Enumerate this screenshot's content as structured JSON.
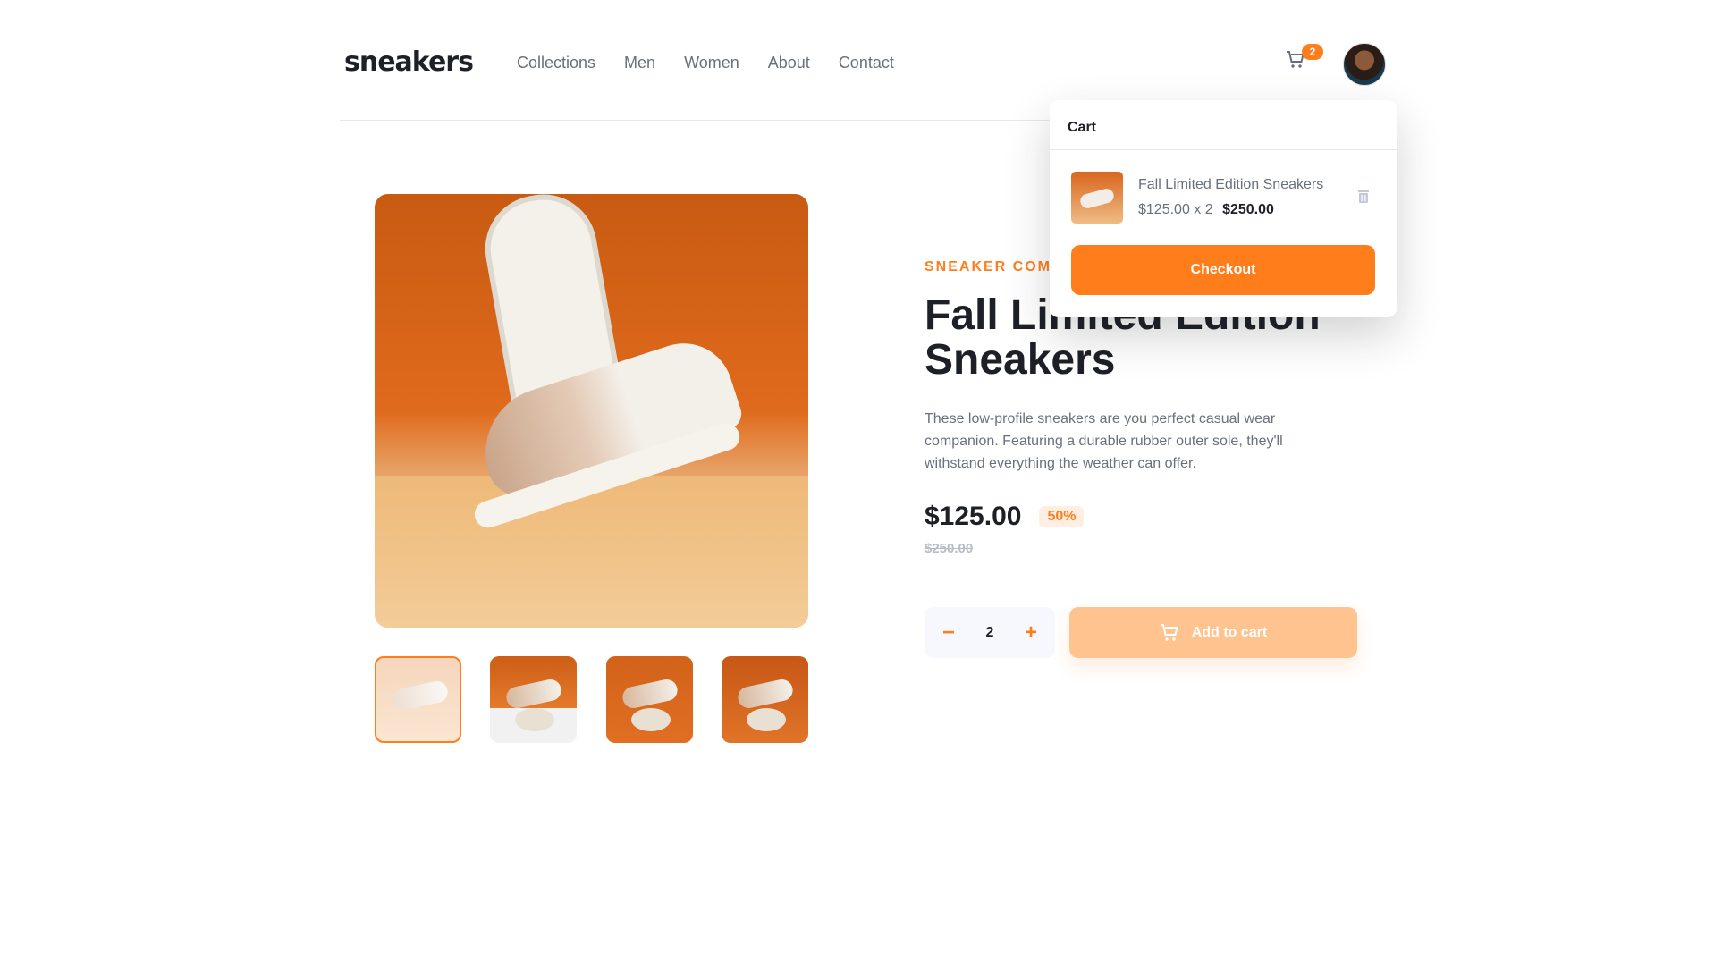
{
  "header": {
    "logo": "sneakers",
    "nav": [
      "Collections",
      "Men",
      "Women",
      "About",
      "Contact"
    ],
    "cart_count": "2",
    "cart_icon": "cart-icon",
    "avatar_icon": "avatar-image"
  },
  "product": {
    "company": "SNEAKER COMPANY",
    "title_line1": "Fall Limited Edition",
    "title_line2": "Sneakers",
    "description": "These low-profile sneakers are you perfect casual wear companion. Featuring a durable rubber outer sole, they'll withstand everything the weather can offer.",
    "price": "$125.00",
    "discount": "50%",
    "old_price": "$250.00",
    "quantity": "2",
    "minus_label": "−",
    "plus_label": "+",
    "add_to_cart": "Add to cart"
  },
  "thumbnails": [
    {
      "name": "thumbnail-1",
      "selected": true
    },
    {
      "name": "thumbnail-2",
      "selected": false
    },
    {
      "name": "thumbnail-3",
      "selected": false
    },
    {
      "name": "thumbnail-4",
      "selected": false
    }
  ],
  "cart": {
    "title": "Cart",
    "item_name": "Fall Limited Edition Sneakers",
    "item_unit": "$125.00 x 2",
    "item_total": "$250.00",
    "checkout_label": "Checkout"
  },
  "colors": {
    "accent": "#ff7e1b",
    "accent_light": "#ffc38f",
    "dark_text": "#1d2026",
    "muted_text": "#69707d"
  }
}
